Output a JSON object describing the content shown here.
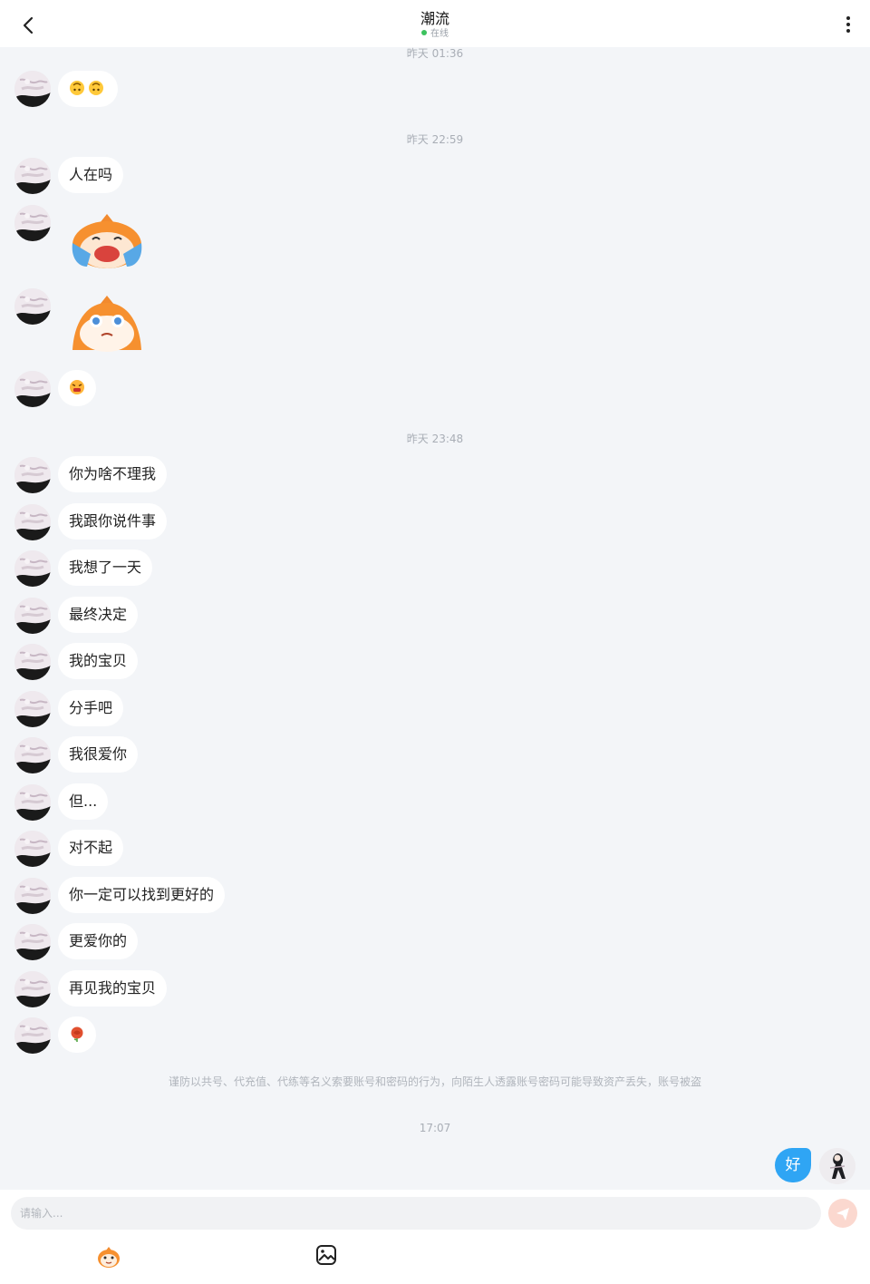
{
  "header": {
    "title": "潮流",
    "status": "在线"
  },
  "timestamps": [
    "昨天 01:36",
    "昨天 22:59",
    "昨天 23:48",
    "17:07"
  ],
  "messages": {
    "m1": "人在吗",
    "m2": "你为啥不理我",
    "m3": "我跟你说件事",
    "m4": "我想了一天",
    "m5": "最终决定",
    "m6": "我的宝贝",
    "m7": "分手吧",
    "m8": "我很爱你",
    "m9": "但...",
    "m10": "对不起",
    "m11": "你一定可以找到更好的",
    "m12": "更爱你的",
    "m13": "再见我的宝贝"
  },
  "emoji_messages": [
    "upside-down-faces",
    "angry-face",
    "rose"
  ],
  "stickers": [
    "crying-fox-sticker",
    "teary-fox-sticker"
  ],
  "notice": "谨防以共号、代充值、代练等名义索要账号和密码的行为，向陌生人透露账号密码可能导致资产丢失，账号被盗",
  "my_message": "好",
  "input": {
    "placeholder": "请输入..."
  },
  "colors": {
    "accent": "#2fa5f4",
    "online": "#3cc25e",
    "background": "#f3f5f8"
  }
}
